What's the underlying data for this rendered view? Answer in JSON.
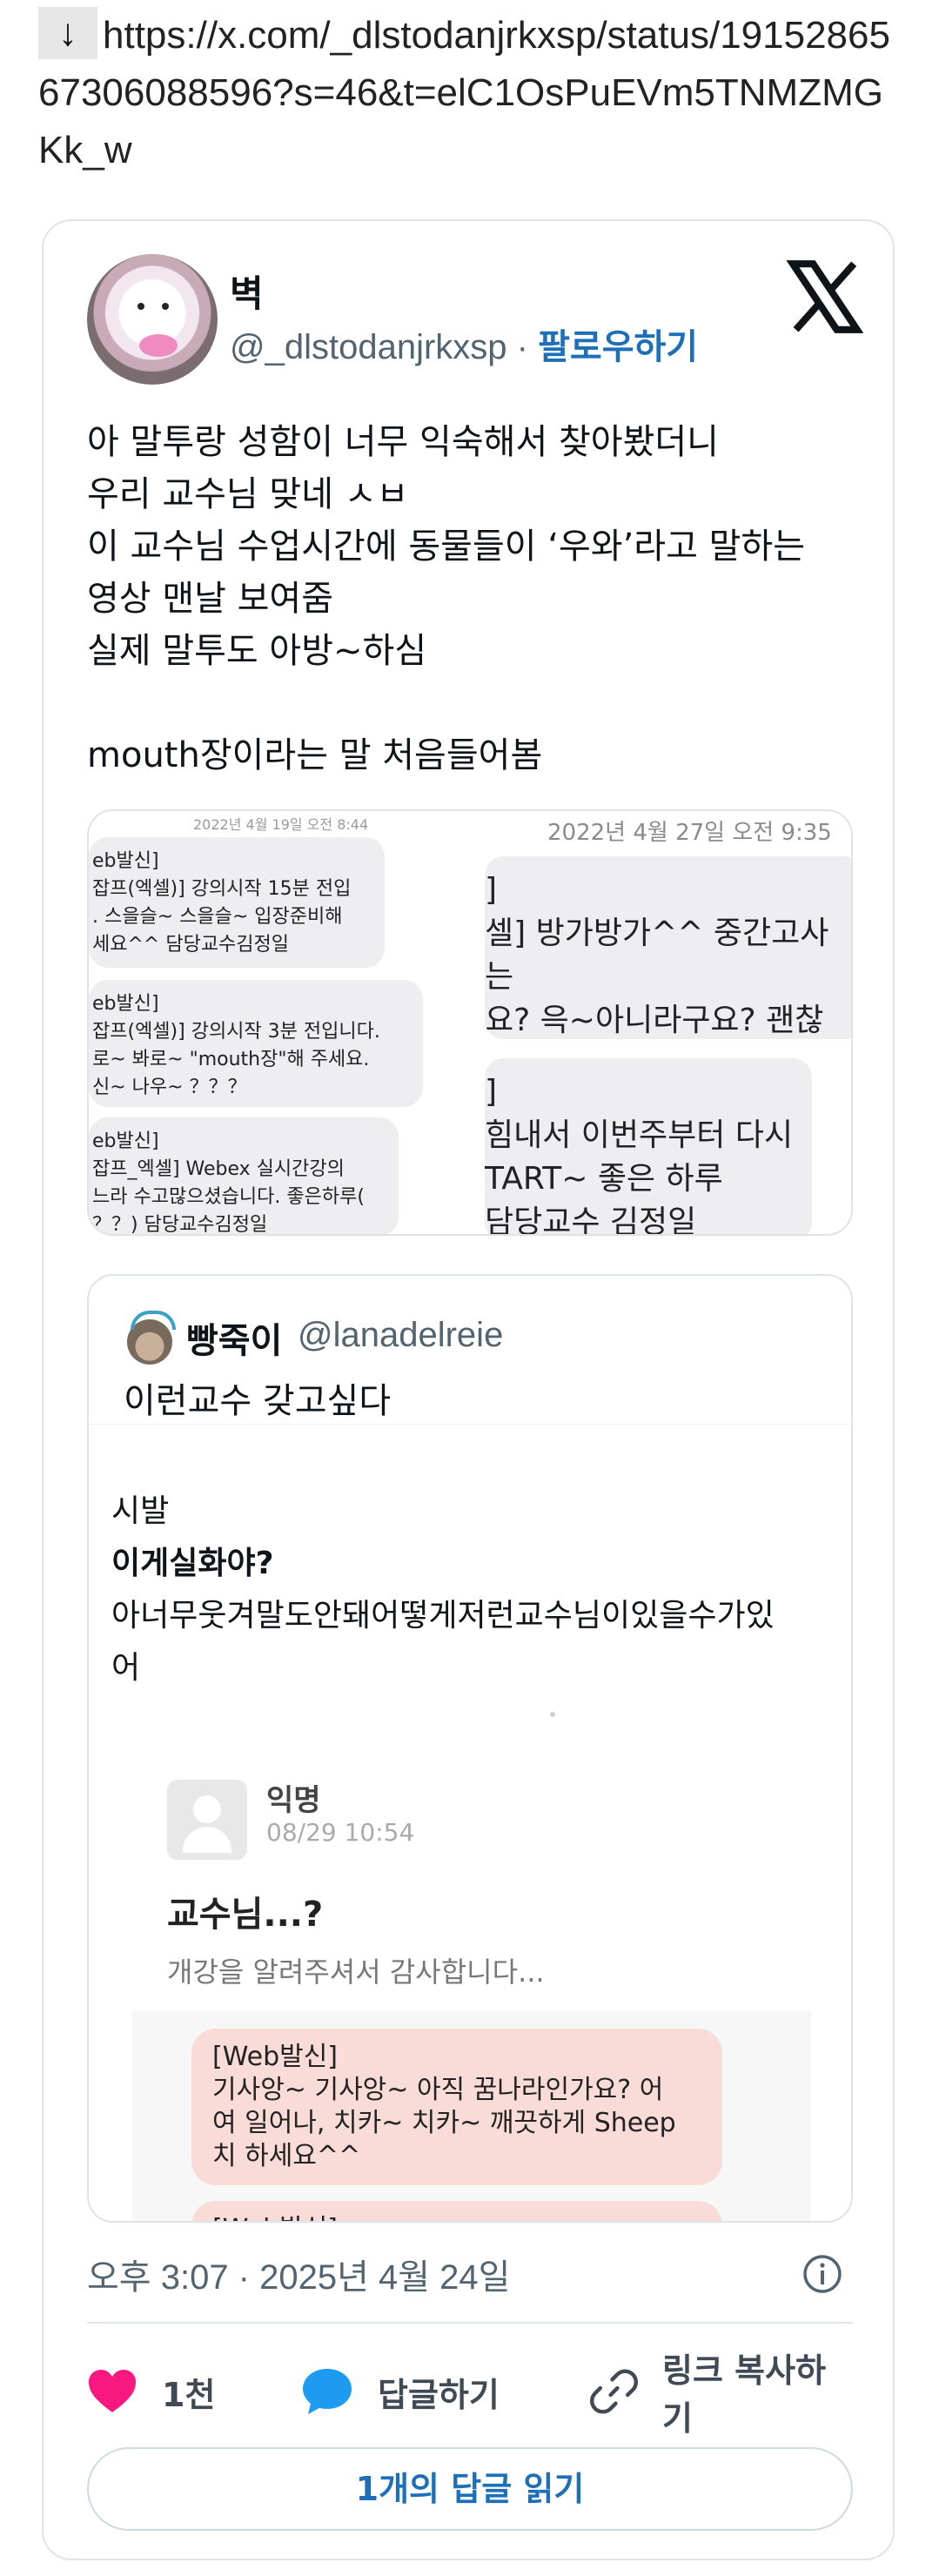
{
  "link": {
    "arrow": "↓",
    "url": "https://x.com/_dlstodanjrkxsp/status/1915286567306088596?s=46&t=elC1OsPuEVm5TNMZMGKk_w"
  },
  "tweet": {
    "author_name": "벽",
    "author_handle": "@_dlstodanjrkxsp",
    "separator": " · ",
    "follow_label": "팔로우하기",
    "brand_icon": "x-logo-icon",
    "text": "아 말투랑 성함이 너무 익숙해서 찾아봤더니\n우리 교수님 맞네 ㅅㅂ\n이 교수님 수업시간에 동물들이 ‘우와’라고 말하는\n영상 맨날 보여줌\n실제 말투도 아방~하심\n\nmouth장이라는 말 처음들어봄",
    "media": {
      "left_timestamp": "2022년 4월 19일 오전 8:44",
      "left_bubbles": [
        "eb발신]\n잡프(엑셀)] 강의시작 15분 전입\n. 스을슬~ 스을슬~ 입장준비해\n세요^^ 담당교수김정일",
        "eb발신]\n잡프(엑셀)] 강의시작 3분 전입니다.\n로~ 봐로~ \"mouth장\"해 주세요.\n신~ 나우~ ？？？",
        "eb발신]\n잡프_엑셀] Webex 실시간강의\n느라 수고많으셨습니다. 좋은하루(\n？？) 담당교수김정일"
      ],
      "right_timestamp": "2022년 4월 27일 오전 9:35",
      "right_bubbles": [
        "]\n셀] 방가방가^^ 중간고사는\n요? 윽~아니라구요? 괜찮\n고사가 있으",
        "]\n힘내서 이번주부터 다시\nTART~  좋은 하루\n담당교수 김정일"
      ]
    },
    "quote": {
      "name": "빵죽이",
      "handle": "@lanadelreie",
      "text": "이런교수 갖고싶다",
      "image": {
        "line1": "시발",
        "line2": "이게실화야?",
        "line3": "아너무웃겨말도안돼어떻게저런교수님이있을수가있\n어",
        "anon_name": "익명",
        "anon_date": "08/29 10:54",
        "post_title": "교수님...?",
        "post_sub": "개강을 알려주셔서 감사합니다...",
        "message1": "[Web발신]\n기사앙~ 기사앙~ 아직 꿈나라인가요? 어\n여 일어나, 치카~ 치카~ 깨끗하게 Sheep\n치 하세요^^",
        "message2": "[Web발신]"
      }
    },
    "timestamp": "오후 3:07 · 2025년 4월 24일",
    "actions": {
      "like_count": "1천",
      "reply_label": "답글하기",
      "copy_link_label": "링크 복사하기"
    },
    "read_replies_label": "1개의 답글 읽기"
  },
  "colors": {
    "accent": "#1d6fb8",
    "heart": "#f91880",
    "reply_bubble": "#1d9bf0",
    "muted": "#536471"
  }
}
